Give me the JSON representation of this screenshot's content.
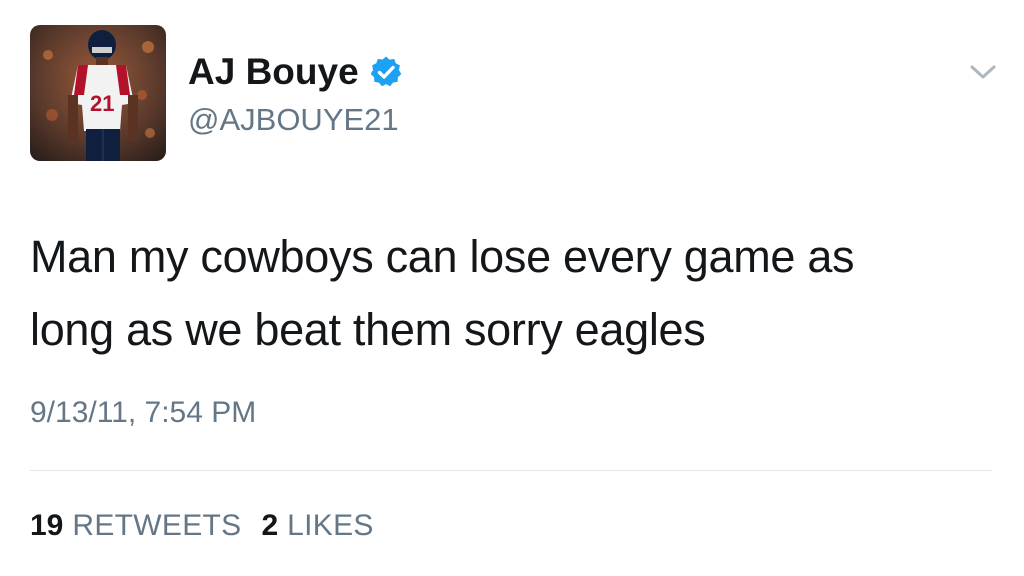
{
  "tweet": {
    "author": {
      "display_name": "AJ Bouye",
      "handle": "@AJBOUYE21",
      "verified": true,
      "avatar_icon": "profile-photo"
    },
    "text_lines": [
      "Man my cowboys can lose every game as",
      "long as we beat them sorry eagles"
    ],
    "timestamp": "9/13/11, 7:54 PM",
    "stats": {
      "retweets": {
        "count": "19",
        "label": "RETWEETS"
      },
      "likes": {
        "count": "2",
        "label": "LIKES"
      }
    },
    "menu_icon": "chevron-down-icon",
    "colors": {
      "verified_badge": "#1da1f2",
      "secondary_text": "#657786",
      "primary_text": "#14171a",
      "divider": "#e1e8ed"
    }
  }
}
